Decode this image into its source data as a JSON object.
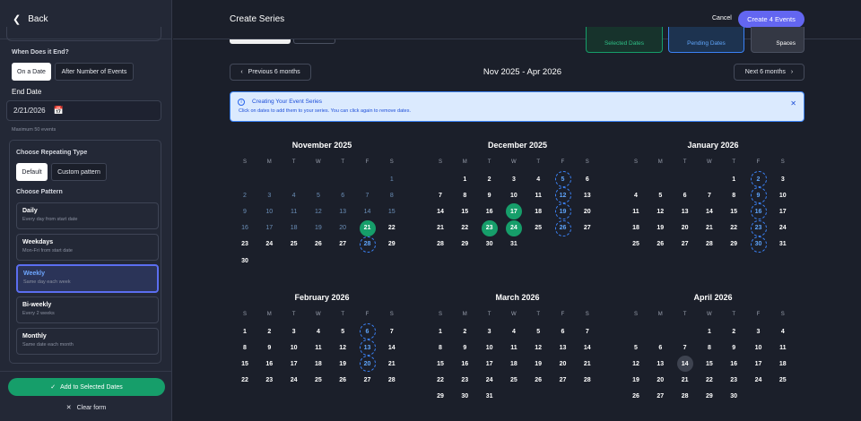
{
  "left": {
    "back_label": "Back",
    "when_end_label": "When Does it End?",
    "end_options": [
      "On a Date",
      "After Number of Events"
    ],
    "end_date_label": "End Date",
    "end_date_value": "2/21/2026",
    "max_events": "Maximum 50 events",
    "repeat_label": "Choose Repeating Type",
    "repeat_options": [
      "Default",
      "Custom pattern"
    ],
    "pattern_label": "Choose Pattern",
    "patterns": [
      {
        "title": "Daily",
        "sub": "Every day from start date"
      },
      {
        "title": "Weekdays",
        "sub": "Mon-Fri from start date"
      },
      {
        "title": "Weekly",
        "sub": "Same day each week"
      },
      {
        "title": "Bi-weekly",
        "sub": "Every 2 weeks"
      },
      {
        "title": "Monthly",
        "sub": "Same date each month"
      }
    ],
    "selected_pattern": 2,
    "add_button": "Add to Selected Dates",
    "clear_button": "Clear form"
  },
  "header": {
    "title": "Create Series",
    "cancel": "Cancel",
    "create": "Create 4 Events"
  },
  "legend": {
    "selected": "Selected Dates",
    "pending": "Pending Dates",
    "spaces": "Spaces"
  },
  "nav": {
    "prev": "Previous 6 months",
    "next": "Next 6 months",
    "range": "Nov 2025 - Apr 2026"
  },
  "banner": {
    "title": "Creating Your Event Series",
    "text": "Click on dates to add them to your series. You can click again to remove dates."
  },
  "weekdays": [
    "S",
    "M",
    "T",
    "W",
    "T",
    "F",
    "S"
  ],
  "colors": {
    "accent": "#6366f1",
    "selected": "#169e6a",
    "pending": "#3b82f6",
    "background": "#1b1f2a"
  },
  "months": [
    {
      "name": "November 2025",
      "start": 6,
      "days": 30,
      "past_until": 20,
      "selected": [
        21
      ],
      "pending": [
        28
      ],
      "today": null
    },
    {
      "name": "December 2025",
      "start": 1,
      "days": 31,
      "past_until": 0,
      "selected": [
        17,
        23,
        24
      ],
      "pending": [
        5,
        12,
        19,
        26
      ],
      "today": null
    },
    {
      "name": "January 2026",
      "start": 4,
      "days": 31,
      "past_until": 0,
      "selected": [],
      "pending": [
        2,
        9,
        16,
        23,
        30
      ],
      "today": null
    },
    {
      "name": "February 2026",
      "start": 0,
      "days": 28,
      "past_until": 0,
      "selected": [],
      "pending": [
        6,
        13,
        20
      ],
      "today": null
    },
    {
      "name": "March 2026",
      "start": 0,
      "days": 31,
      "past_until": 0,
      "selected": [],
      "pending": [],
      "today": null
    },
    {
      "name": "April 2026",
      "start": 3,
      "days": 30,
      "past_until": 0,
      "selected": [],
      "pending": [],
      "today": 14
    }
  ]
}
